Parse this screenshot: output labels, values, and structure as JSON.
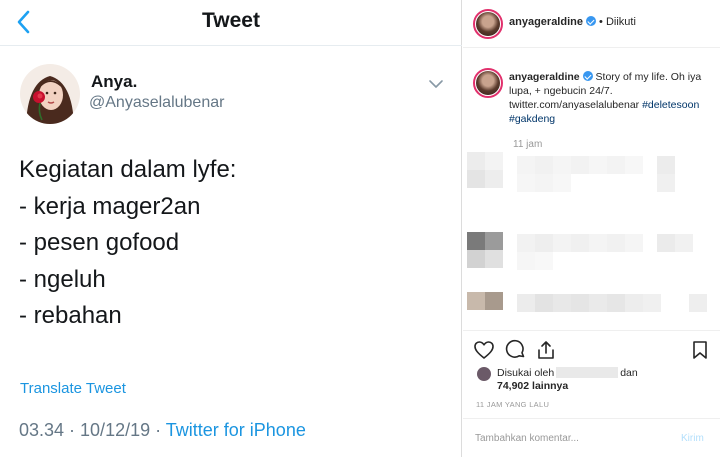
{
  "twitter": {
    "header_title": "Tweet",
    "name": "Anya.",
    "handle": "@Anyaselalubenar",
    "tweet_lines": [
      "Kegiatan dalam lyfe:",
      "- kerja mager2an",
      "- pesen gofood",
      "- ngeluh",
      "- rebahan"
    ],
    "translate_label": "Translate Tweet",
    "timestamp": "03.34 · 10/12/19 · ",
    "source": "Twitter for iPhone"
  },
  "instagram": {
    "header_username": "anyageraldine",
    "follow_status": " • Diikuti",
    "caption_user": "anyageraldine",
    "caption_text": " Story of my life. Oh iya lupa, + ngebucin 24/7. twitter.com/anyaselalubenar ",
    "caption_tags": "#deletesoon #gakdeng",
    "comment_time": "11 jam",
    "liked_prefix": "Disukai oleh",
    "liked_suffix": "dan",
    "likes_count": "74,902",
    "likes_suffix": "lainnya",
    "time_ago": "11 JAM YANG LALU",
    "comment_placeholder": "Tambahkan komentar...",
    "send_label": "Kirim"
  }
}
